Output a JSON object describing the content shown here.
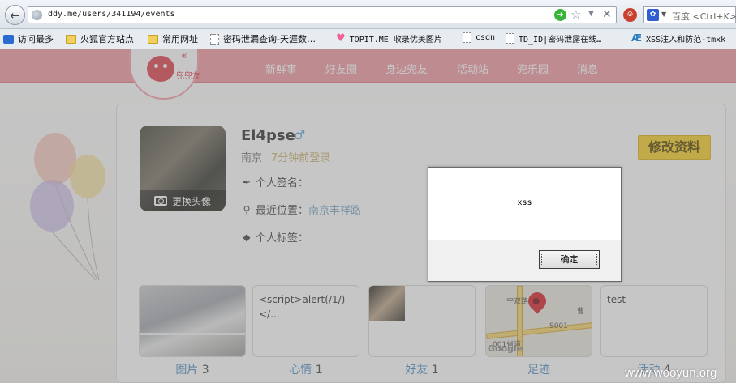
{
  "browser": {
    "url": "ddy.me/users/341194/events",
    "search_placeholder": "百度 <Ctrl+K>",
    "bookmarks": [
      {
        "label": "访问最多",
        "icon": "rss-icon"
      },
      {
        "label": "火狐官方站点",
        "icon": "folder-icon"
      },
      {
        "label": "常用网址",
        "icon": "folder-icon"
      },
      {
        "label": "密码泄漏查询-天涯数…",
        "icon": "page-icon"
      },
      {
        "label": "TOPIT.ME 收录优美图片",
        "icon": "heart-icon"
      },
      {
        "label": "csdn",
        "icon": "page-icon"
      },
      {
        "label": "TD_ID|密码泄露在线…",
        "icon": "page-icon"
      },
      {
        "label": "XSS注入和防范-tmxk",
        "icon": "ae-icon"
      }
    ]
  },
  "site": {
    "logo_text": "兜兜友",
    "logo_reg": "®",
    "nav": [
      "新鲜事",
      "好友圈",
      "身边兜友",
      "活动站",
      "兜乐园",
      "消息"
    ]
  },
  "profile": {
    "avatar_action": "更换头像",
    "username": "El4pse",
    "gender_symbol": "♂",
    "city": "南京",
    "last_login": "7分钟前登录",
    "signature_label": "个人签名：",
    "location_label": "最近位置：",
    "location_value": "南京丰祥路",
    "tags_label": "个人标签：",
    "edit_button": "修改资料"
  },
  "tiles": [
    {
      "label": "图片",
      "count": "3"
    },
    {
      "label": "心情",
      "count": "1",
      "preview": "<script>alert(/1/)</..."
    },
    {
      "label": "好友",
      "count": "1"
    },
    {
      "label": "足迹",
      "count": "",
      "map_labels": [
        "宁双路",
        "001省道",
        "S001",
        "曹",
        "Google"
      ]
    },
    {
      "label": "活动",
      "count": "4",
      "preview": "test"
    }
  ],
  "dialog": {
    "message": "xss",
    "ok_label": "确定"
  },
  "watermark": "www.wooyun.org"
}
